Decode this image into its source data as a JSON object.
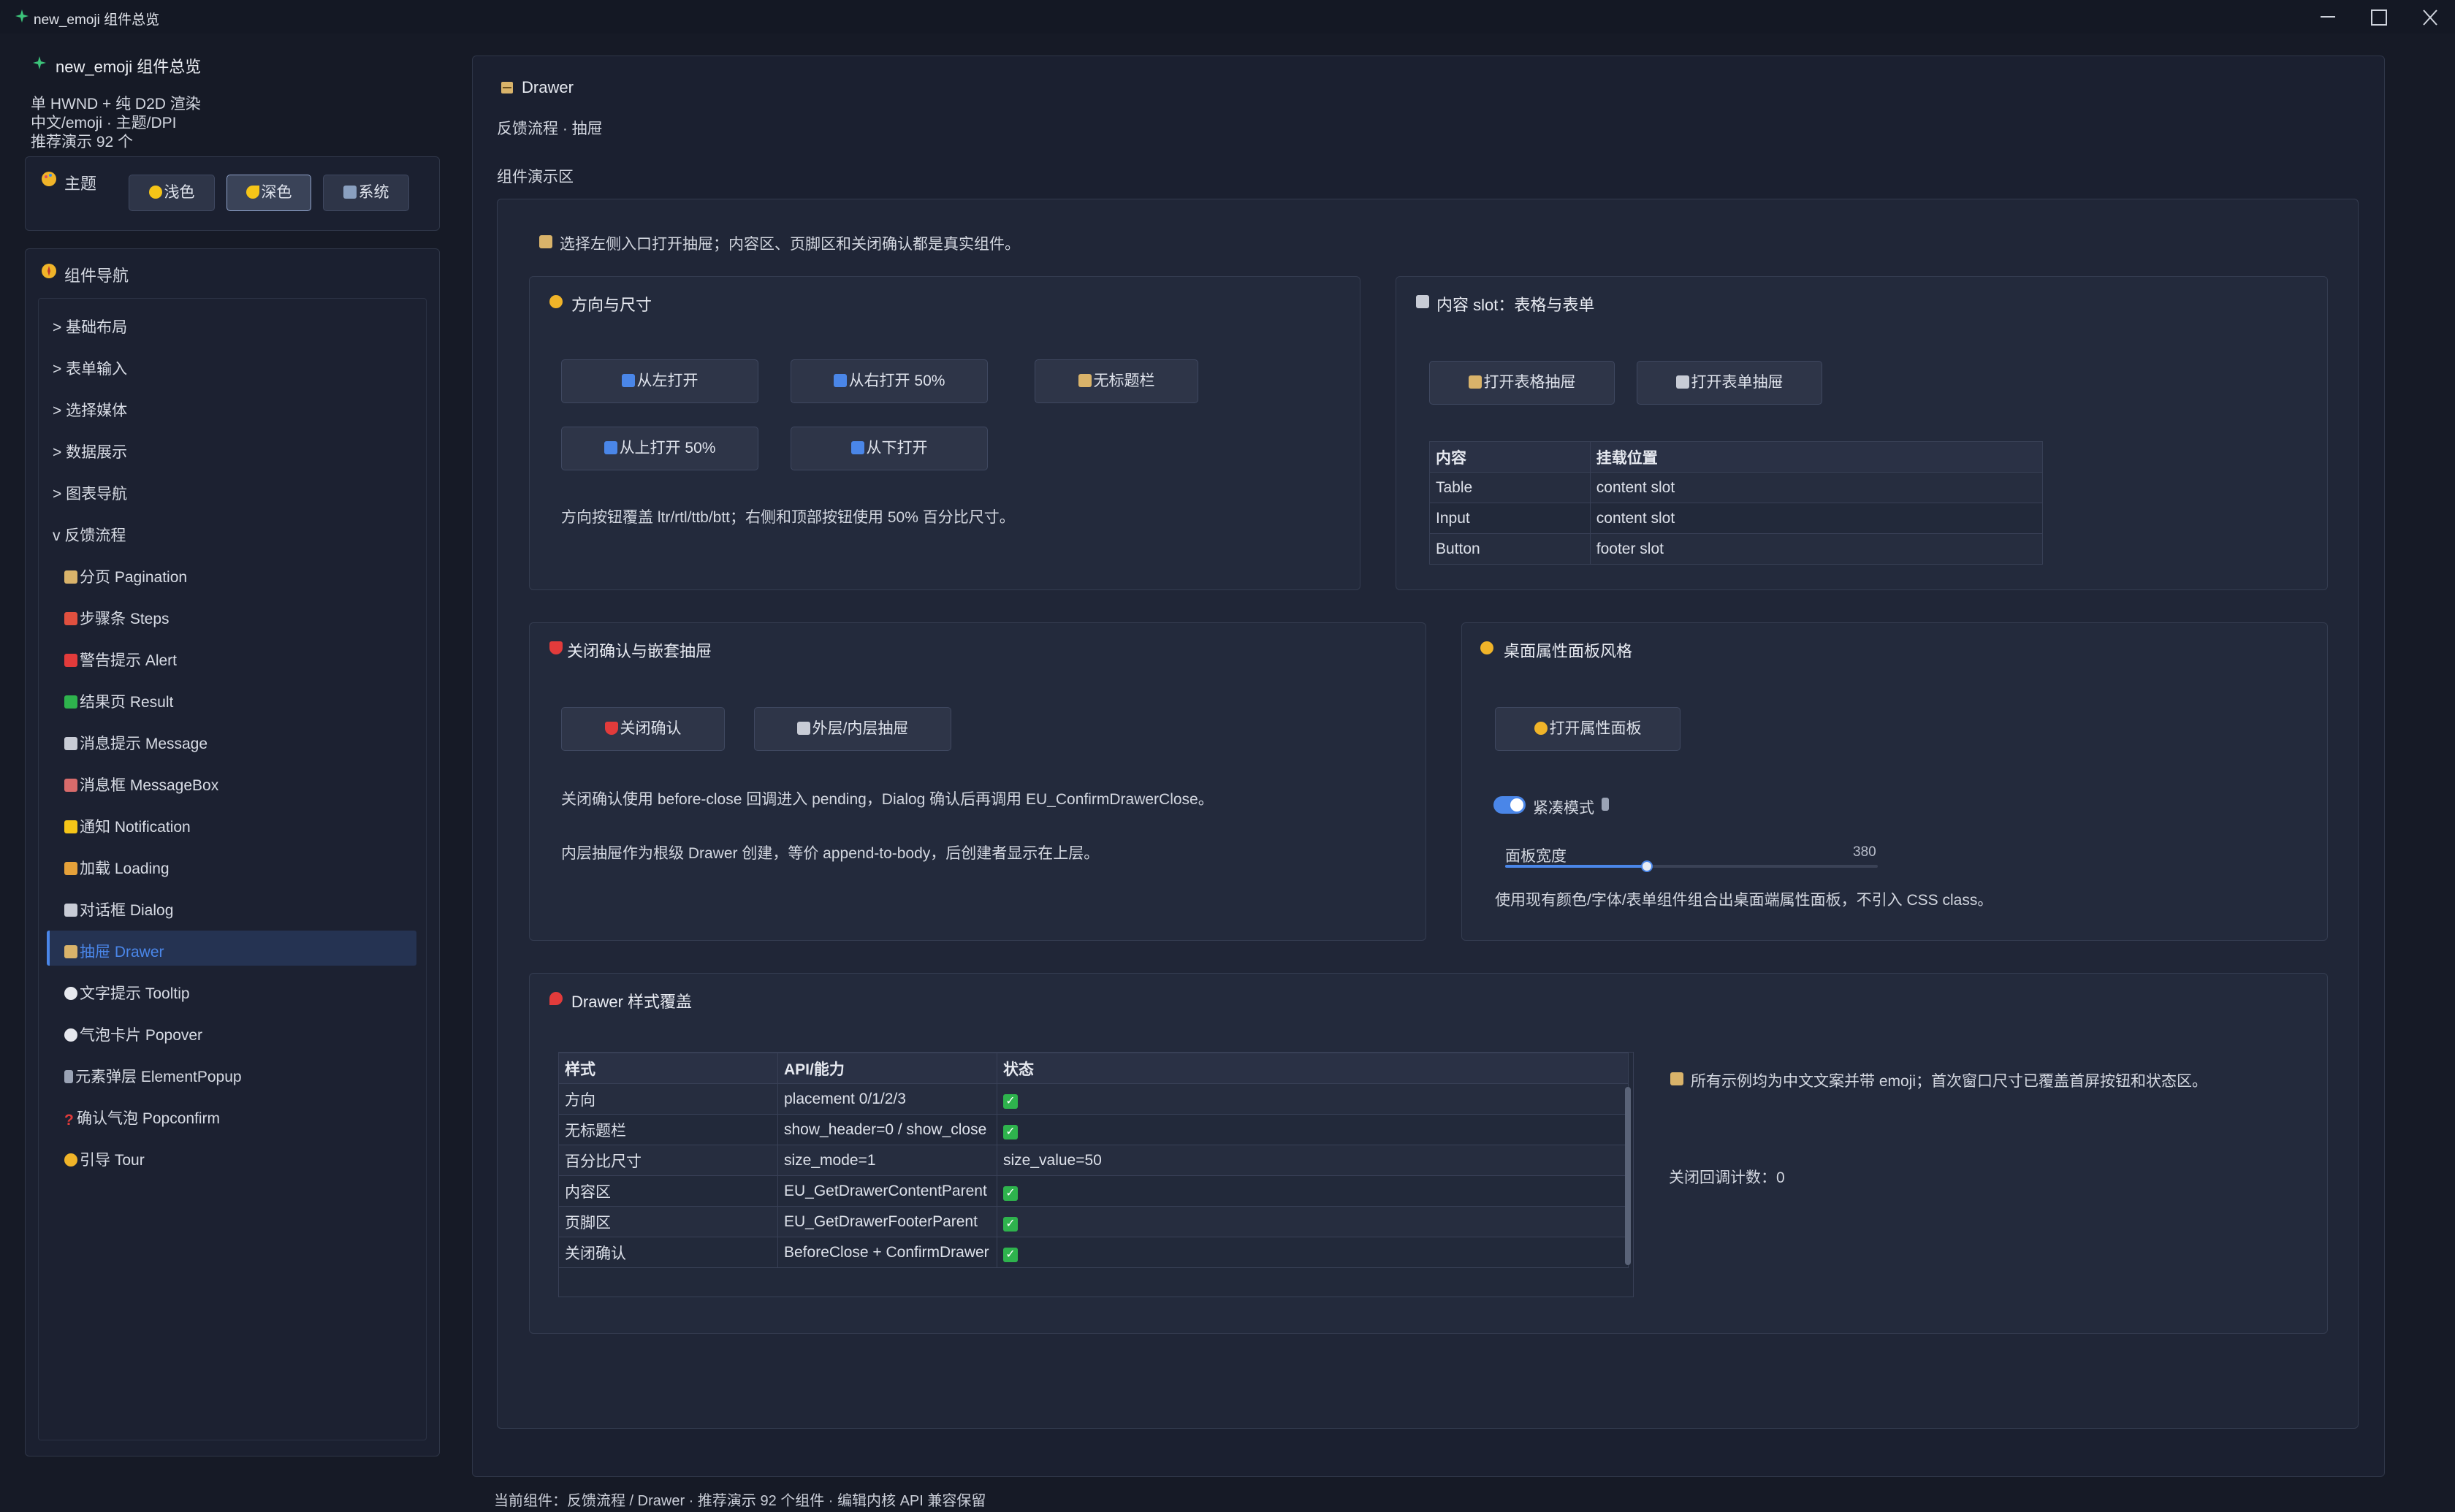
{
  "window": {
    "title": "new_emoji 组件总览",
    "buttons": {
      "minimize": "—",
      "maximize": "☐",
      "close": "✕"
    }
  },
  "sidebar": {
    "app_title": "new_emoji 组件总览",
    "info_lines": [
      "单 HWND + 纯 D2D 渲染",
      "中文/emoji · 主题/DPI",
      "推荐演示 92 个"
    ],
    "theme": {
      "label": "主题",
      "options": [
        {
          "label": "浅色",
          "active": false
        },
        {
          "label": "深色",
          "active": true
        },
        {
          "label": "系统",
          "active": false
        }
      ]
    },
    "nav": {
      "title": "组件导航",
      "groups": [
        {
          "label": "> 基础布局"
        },
        {
          "label": "> 表单输入"
        },
        {
          "label": "> 选择媒体"
        },
        {
          "label": "> 数据展示"
        },
        {
          "label": "> 图表导航"
        },
        {
          "label": "v 反馈流程"
        }
      ],
      "items": [
        {
          "label": "分页 Pagination",
          "icon": "page-icon"
        },
        {
          "label": "步骤条 Steps",
          "icon": "footprints-icon"
        },
        {
          "label": "警告提示 Alert",
          "icon": "siren-icon"
        },
        {
          "label": "结果页 Result",
          "icon": "check-icon"
        },
        {
          "label": "消息提示 Message",
          "icon": "message-icon"
        },
        {
          "label": "消息框 MessageBox",
          "icon": "mailbox-icon"
        },
        {
          "label": "通知 Notification",
          "icon": "bell-icon"
        },
        {
          "label": "加载 Loading",
          "icon": "hourglass-icon"
        },
        {
          "label": "对话框 Dialog",
          "icon": "dialog-icon"
        },
        {
          "label": "抽屉 Drawer",
          "icon": "drawer-icon",
          "selected": true
        },
        {
          "label": "文字提示 Tooltip",
          "icon": "speech-icon"
        },
        {
          "label": "气泡卡片 Popover",
          "icon": "bubble-icon"
        },
        {
          "label": "元素弹层 ElementPopup",
          "icon": "phone-icon"
        },
        {
          "label": "确认气泡 Popconfirm",
          "icon": "question-icon"
        },
        {
          "label": "引导 Tour",
          "icon": "compass-icon"
        }
      ]
    }
  },
  "main": {
    "title": "Drawer",
    "breadcrumb": "反馈流程 · 抽屉",
    "demo_label": "组件演示区",
    "hint": "选择左侧入口打开抽屉；内容区、页脚区和关闭确认都是真实组件。",
    "direction": {
      "title": "方向与尺寸",
      "buttons": [
        "从左打开",
        "从右打开 50%",
        "无标题栏",
        "从上打开 50%",
        "从下打开"
      ],
      "note": "方向按钮覆盖 ltr/rtl/ttb/btt；右侧和顶部按钮使用 50% 百分比尺寸。"
    },
    "content_slot": {
      "title": "内容 slot：表格与表单",
      "buttons": [
        "打开表格抽屉",
        "打开表单抽屉"
      ],
      "headers": [
        "内容",
        "挂载位置"
      ],
      "rows": [
        [
          "Table",
          "content slot"
        ],
        [
          "Input",
          "content slot"
        ],
        [
          "Button",
          "footer slot"
        ]
      ]
    },
    "close_confirm": {
      "title": "关闭确认与嵌套抽屉",
      "buttons": [
        "关闭确认",
        "外层/内层抽屉"
      ],
      "note1": "关闭确认使用 before-close 回调进入 pending，Dialog 确认后再调用 EU_ConfirmDrawerClose。",
      "note2": "内层抽屉作为根级 Drawer 创建，等价 append-to-body，后创建者显示在上层。"
    },
    "desktop_panel": {
      "title": "桌面属性面板风格",
      "button": "打开属性面板",
      "toggle_label": "紧凑模式",
      "toggle_on": true,
      "slider_label": "面板宽度",
      "slider_value": "380",
      "slider_fraction": 0.38,
      "note": "使用现有颜色/字体/表单组件组合出桌面端属性面板，不引入 CSS class。"
    },
    "style_override": {
      "title": "Drawer 样式覆盖",
      "headers": [
        "样式",
        "API/能力",
        "状态"
      ],
      "rows": [
        {
          "style": "方向",
          "api": "placement 0/1/2/3",
          "status": "✓"
        },
        {
          "style": "无标题栏",
          "api": "show_header=0 / show_close",
          "status": "✓"
        },
        {
          "style": "百分比尺寸",
          "api": "size_mode=1",
          "status": "size_value=50"
        },
        {
          "style": "内容区",
          "api": "EU_GetDrawerContentParent",
          "status": "✓"
        },
        {
          "style": "页脚区",
          "api": "EU_GetDrawerFooterParent",
          "status": "✓"
        },
        {
          "style": "关闭确认",
          "api": "BeforeClose + ConfirmDrawer",
          "status": "✓"
        }
      ],
      "side_note": "所有示例均为中文文案并带 emoji；首次窗口尺寸已覆盖首屏按钮和状态区。",
      "counter": "关闭回调计数：0"
    },
    "status_bar": "当前组件：反馈流程 / Drawer · 推荐演示 92 个组件 · 编辑内核 API 兼容保留"
  },
  "colors": {
    "accent": "#4a86e8",
    "success": "#2eb34d",
    "background": "#161a26"
  }
}
